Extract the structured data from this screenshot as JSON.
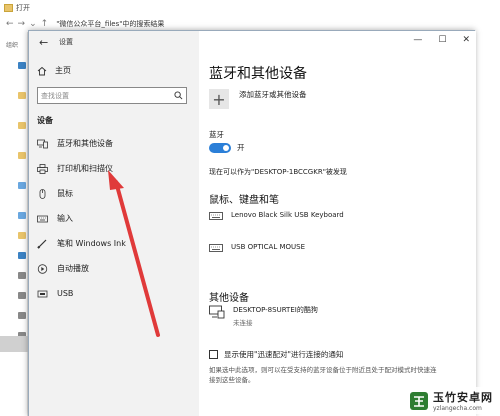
{
  "explorer": {
    "title": "打开",
    "address": "\"微信公众平台_files\"中的搜索结果",
    "side_label": "组织"
  },
  "settings": {
    "window_title": "设置",
    "home_label": "主页",
    "search_placeholder": "查找设置",
    "section_header": "设备",
    "nav_items": [
      {
        "label": "蓝牙和其他设备",
        "icon": "bluetooth-devices-icon"
      },
      {
        "label": "打印机和扫描仪",
        "icon": "printer-icon"
      },
      {
        "label": "鼠标",
        "icon": "mouse-icon"
      },
      {
        "label": "输入",
        "icon": "keyboard-icon"
      },
      {
        "label": "笔和 Windows Ink",
        "icon": "pen-icon"
      },
      {
        "label": "自动播放",
        "icon": "autoplay-icon"
      },
      {
        "label": "USB",
        "icon": "usb-icon"
      }
    ],
    "page_title": "蓝牙和其他设备",
    "add_device_label": "添加蓝牙或其他设备",
    "bluetooth_label": "蓝牙",
    "toggle_state": "开",
    "discoverable_text": "现在可以作为\"DESKTOP-1BCCGKR\"被发现",
    "input_section_title": "鼠标、键盘和笔",
    "input_devices": [
      {
        "name": "Lenovo Black Silk USB Keyboard",
        "icon": "keyboard-icon"
      },
      {
        "name": "USB OPTICAL MOUSE",
        "icon": "keyboard-icon"
      }
    ],
    "other_section_title": "其他设备",
    "other_devices": [
      {
        "name": "DESKTOP-8SURTEI的酷狗",
        "status": "未连接",
        "icon": "monitor-icon"
      }
    ],
    "swift_pair_label": "显示使用\"迅速配对\"进行连接的通知",
    "swift_pair_help": "如果选中此选项，则可以在受支持的蓝牙设备位于附近且处于配对模式时快速连接到这些设备。"
  },
  "watermark": {
    "name": "玉竹安卓网",
    "url": "yzlangecha.com"
  },
  "colors": {
    "accent": "#2b7fd8",
    "arrow": "#e03a3a"
  }
}
